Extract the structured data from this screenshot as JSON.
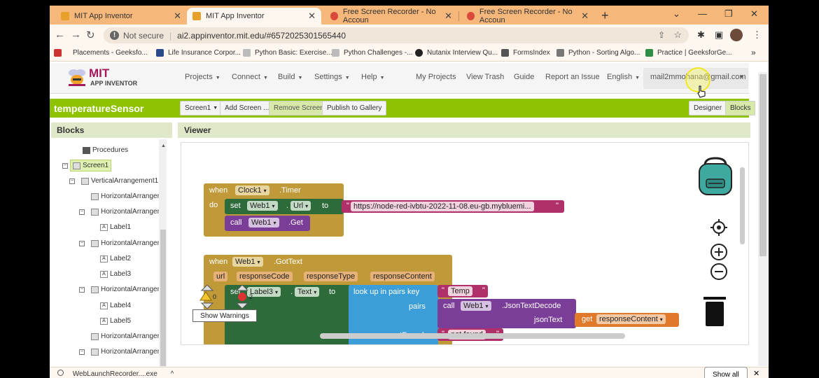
{
  "browser": {
    "tabs": [
      {
        "title": "MIT App Inventor",
        "active": false
      },
      {
        "title": "MIT App Inventor",
        "active": true
      },
      {
        "title": "Free Screen Recorder - No Accoun",
        "active": false
      },
      {
        "title": "Free Screen Recorder - No Accoun",
        "active": false
      }
    ],
    "security_label": "Not secure",
    "url": "ai2.appinventor.mit.edu/#6572025301565440",
    "bookmarks": [
      "Placements - Geeksfo...",
      "Life Insurance Corpor...",
      "Python Basic: Exercise...",
      "Python Challenges -...",
      "Nutanix Interview Qu...",
      "FormsIndex",
      "Python - Sorting Algo...",
      "Practice | GeeksforGe..."
    ]
  },
  "app": {
    "logo_mit": "MIT",
    "logo_sub": "APP INVENTOR",
    "menu": [
      "Projects",
      "Connect",
      "Build",
      "Settings",
      "Help"
    ],
    "links": [
      "My Projects",
      "View Trash",
      "Guide",
      "Report an Issue",
      "English"
    ],
    "account": "mail2mmohana@gmail.com",
    "project_name": "temperatureSensor",
    "toolbar": [
      "Screen1",
      "Add Screen ...",
      "Remove Screen",
      "Publish to Gallery"
    ],
    "view_buttons": [
      "Designer",
      "Blocks"
    ],
    "blocks_title": "Blocks",
    "viewer_title": "Viewer",
    "tree": [
      {
        "label": "Procedures",
        "level": 1,
        "toggle": ""
      },
      {
        "label": "Screen1",
        "level": 0,
        "toggle": "−"
      },
      {
        "label": "VerticalArrangement1",
        "level": 1,
        "toggle": "−"
      },
      {
        "label": "HorizontalArrangen",
        "level": 2,
        "toggle": ""
      },
      {
        "label": "HorizontalArrangen",
        "level": 2,
        "toggle": "−"
      },
      {
        "label": "Label1",
        "level": 3,
        "toggle": ""
      },
      {
        "label": "HorizontalArrangen",
        "level": 2,
        "toggle": "−"
      },
      {
        "label": "Label2",
        "level": 3,
        "toggle": ""
      },
      {
        "label": "Label3",
        "level": 3,
        "toggle": ""
      },
      {
        "label": "HorizontalArrangen",
        "level": 2,
        "toggle": "−"
      },
      {
        "label": "Label4",
        "level": 3,
        "toggle": ""
      },
      {
        "label": "Label5",
        "level": 3,
        "toggle": ""
      },
      {
        "label": "HorizontalArrangen",
        "level": 2,
        "toggle": ""
      },
      {
        "label": "HorizontalArrangen",
        "level": 2,
        "toggle": "−"
      }
    ],
    "blocks": {
      "when": "when",
      "do": "do",
      "clock": "Clock1",
      "timer": ".Timer",
      "set": "set",
      "web1": "Web1",
      "url_prop": "Url",
      "to": "to",
      "url_value": "https://node-red-ivbtu-2022-11-08.eu-gb.mybluemi...",
      "call": "call",
      "get": ".Get",
      "gottext": ".GotText",
      "params": [
        "url",
        "responseCode",
        "responseType",
        "responseContent"
      ],
      "set_label3": "Label3",
      "text_prop": "Text",
      "lookup": "look up in pairs  key",
      "temp": "Temp",
      "pairs": "pairs",
      "json_decode": ".JsonTextDecode",
      "json_text": "jsonText",
      "get_word": "get",
      "get_var": "responseContent",
      "not_found_label": "notFound",
      "not_found_value": "not found"
    },
    "warnings": {
      "count": "0",
      "errors": "2",
      "button": "Show Warnings"
    }
  },
  "downloads": {
    "file": "WebLaunchRecorder....exe",
    "show_all": "Show all"
  }
}
